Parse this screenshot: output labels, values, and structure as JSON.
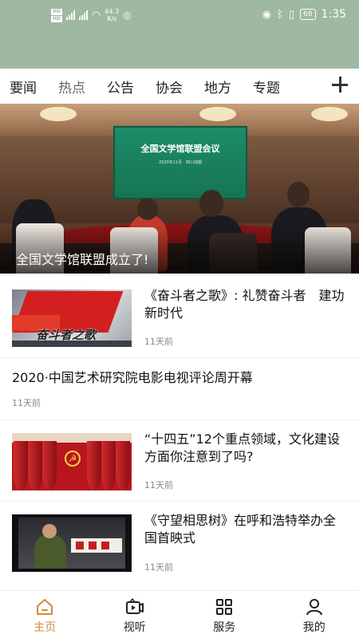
{
  "status_bar": {
    "network_speed": "64.3",
    "network_unit": "K/s",
    "battery": "68",
    "time": "1:35"
  },
  "tabs": [
    {
      "label": "要闻"
    },
    {
      "label": "热点"
    },
    {
      "label": "公告"
    },
    {
      "label": "协会"
    },
    {
      "label": "地方"
    },
    {
      "label": "专题"
    }
  ],
  "banner": {
    "screen_title": "全国文学馆联盟会议",
    "screen_subtitle": "2020年11月　四川成都",
    "caption": "全国文学馆联盟成立了!"
  },
  "news": [
    {
      "title": "《奋斗者之歌》: 礼赞奋斗者　建功新时代",
      "time": "11天前",
      "thumb_text": "奋斗者之歌"
    },
    {
      "title": "2020·中国艺术研究院电影电视评论周开幕",
      "time": "11天前"
    },
    {
      "title": "“十四五”12个重点领域，文化建设方面你注意到了吗?",
      "time": "11天前"
    },
    {
      "title": "《守望相思树》在呼和浩特举办全国首映式",
      "time": "11天前"
    }
  ],
  "bottom_nav": [
    {
      "label": "主页",
      "icon": "home-icon",
      "active": true
    },
    {
      "label": "视听",
      "icon": "video-icon",
      "active": false
    },
    {
      "label": "服务",
      "icon": "grid-icon",
      "active": false
    },
    {
      "label": "我的",
      "icon": "person-icon",
      "active": false
    }
  ],
  "colors": {
    "status_bar": "#9fb8a0",
    "accent": "#d18a3a"
  }
}
